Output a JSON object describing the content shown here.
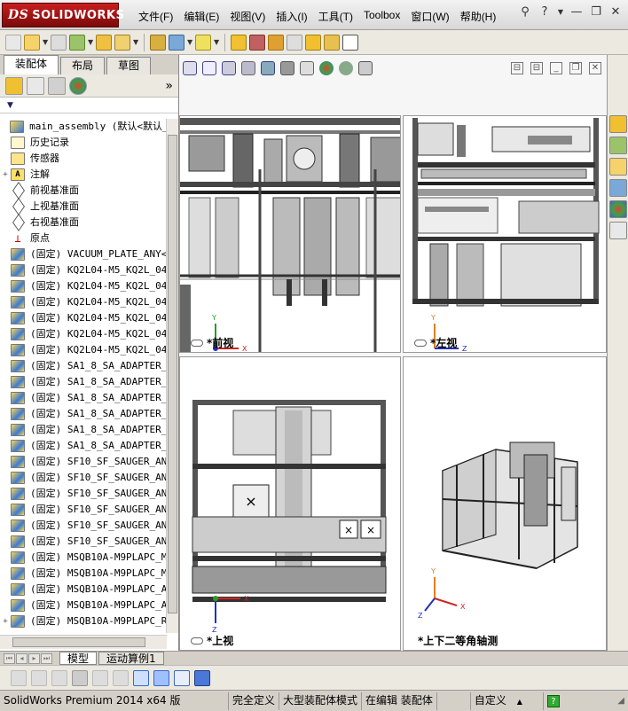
{
  "app": {
    "brand_prefix": "DS",
    "brand": "SOLIDWORKS"
  },
  "menu": [
    "文件(F)",
    "编辑(E)",
    "视图(V)",
    "插入(I)",
    "工具(T)",
    "Toolbox",
    "窗口(W)",
    "帮助(H)"
  ],
  "panel": {
    "tabs": [
      "装配体",
      "布局",
      "草图"
    ],
    "expand_glyph": "»",
    "filter_glyph": "▼"
  },
  "tree": [
    {
      "text": "main_assembly  (默认<默认_显",
      "icon": "asm",
      "exp": ""
    },
    {
      "text": "历史记录",
      "icon": "hist",
      "exp": ""
    },
    {
      "text": "传感器",
      "icon": "sens",
      "exp": ""
    },
    {
      "text": "注解",
      "icon": "note",
      "exp": "+"
    },
    {
      "text": "前视基准面",
      "icon": "plane",
      "exp": ""
    },
    {
      "text": "上视基准面",
      "icon": "plane",
      "exp": ""
    },
    {
      "text": "右视基准面",
      "icon": "plane",
      "exp": ""
    },
    {
      "text": "原点",
      "icon": "origin",
      "exp": ""
    },
    {
      "text": "(固定) VACUUM_PLATE_ANY<",
      "icon": "part",
      "exp": ""
    },
    {
      "text": "(固定) KQ2L04-M5_KQ2L_04",
      "icon": "part",
      "exp": ""
    },
    {
      "text": "(固定) KQ2L04-M5_KQ2L_04",
      "icon": "part",
      "exp": ""
    },
    {
      "text": "(固定) KQ2L04-M5_KQ2L_04",
      "icon": "part",
      "exp": ""
    },
    {
      "text": "(固定) KQ2L04-M5_KQ2L_04",
      "icon": "part",
      "exp": ""
    },
    {
      "text": "(固定) KQ2L04-M5_KQ2L_04",
      "icon": "part",
      "exp": ""
    },
    {
      "text": "(固定) KQ2L04-M5_KQ2L_04",
      "icon": "part",
      "exp": ""
    },
    {
      "text": "(固定) SA1_8_SA_ADAPTER_",
      "icon": "part",
      "exp": ""
    },
    {
      "text": "(固定) SA1_8_SA_ADAPTER_",
      "icon": "part",
      "exp": ""
    },
    {
      "text": "(固定) SA1_8_SA_ADAPTER_",
      "icon": "part",
      "exp": ""
    },
    {
      "text": "(固定) SA1_8_SA_ADAPTER_",
      "icon": "part",
      "exp": ""
    },
    {
      "text": "(固定) SA1_8_SA_ADAPTER_",
      "icon": "part",
      "exp": ""
    },
    {
      "text": "(固定) SA1_8_SA_ADAPTER_",
      "icon": "part",
      "exp": ""
    },
    {
      "text": "(固定) SF10_SF_SAUGER_AN",
      "icon": "part",
      "exp": ""
    },
    {
      "text": "(固定) SF10_SF_SAUGER_AN",
      "icon": "part",
      "exp": ""
    },
    {
      "text": "(固定) SF10_SF_SAUGER_AN",
      "icon": "part",
      "exp": ""
    },
    {
      "text": "(固定) SF10_SF_SAUGER_AN",
      "icon": "part",
      "exp": ""
    },
    {
      "text": "(固定) SF10_SF_SAUGER_AN",
      "icon": "part",
      "exp": ""
    },
    {
      "text": "(固定) SF10_SF_SAUGER_AN",
      "icon": "part",
      "exp": ""
    },
    {
      "text": "(固定) MSQB10A-M9PLAPC_M",
      "icon": "part",
      "exp": ""
    },
    {
      "text": "(固定) MSQB10A-M9PLAPC_M",
      "icon": "part",
      "exp": ""
    },
    {
      "text": "(固定) MSQB10A-M9PLAPC_A",
      "icon": "part",
      "exp": ""
    },
    {
      "text": "(固定) MSQB10A-M9PLAPC_A",
      "icon": "part",
      "exp": ""
    },
    {
      "text": "(固定) MSQB10A-M9PLAPC_R",
      "icon": "part",
      "exp": "+"
    }
  ],
  "views": {
    "front": "*前视",
    "left": "*左视",
    "top": "*上视",
    "iso": "*上下二等角轴测"
  },
  "axes": {
    "x": "X",
    "y": "Y",
    "z": "Z"
  },
  "bottom_tabs": [
    "模型",
    "运动算例1"
  ],
  "status": {
    "product": "SolidWorks Premium 2014 x64 版",
    "definition": "完全定义",
    "mode": "大型装配体模式",
    "editing": "在编辑 装配体",
    "units": "自定义",
    "units_arrow": "▲",
    "help": "?"
  },
  "colors": {
    "axis_x": "#d42020",
    "axis_y": "#20a020",
    "axis_z": "#2030c0",
    "axis_origin": "#e08020"
  }
}
